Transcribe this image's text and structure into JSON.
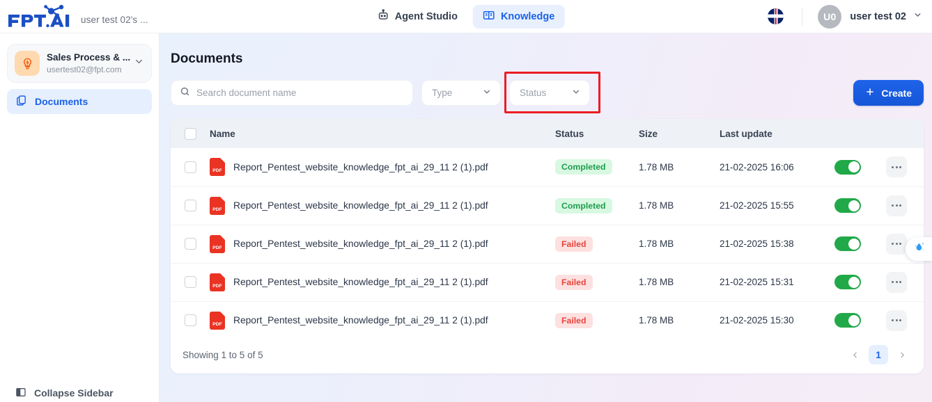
{
  "brand": {
    "name": "FPT.AI",
    "workspace_label": "user test 02's ..."
  },
  "topnav": {
    "items": [
      {
        "label": "Agent Studio",
        "icon": "robot-icon",
        "active": false
      },
      {
        "label": "Knowledge",
        "icon": "book-icon",
        "active": true
      }
    ]
  },
  "topright": {
    "language_icon": "uk-flag-icon",
    "avatar_initials": "U0",
    "user_name": "user test 02",
    "chevron_icon": "chevron-down-icon"
  },
  "sidebar": {
    "workspace": {
      "icon": "lightbulb-icon",
      "title": "Sales Process & ...",
      "email": "usertest02@fpt.com",
      "chevron_icon": "chevron-down-icon"
    },
    "items": [
      {
        "label": "Documents",
        "icon": "documents-icon",
        "active": true
      }
    ],
    "collapse": {
      "label": "Collapse Sidebar",
      "icon": "panel-collapse-icon"
    }
  },
  "main": {
    "title": "Documents",
    "search": {
      "placeholder": "Search document name",
      "value": "",
      "icon": "search-icon"
    },
    "type_filter": {
      "label": "Type",
      "value": "",
      "icon": "chevron-down-icon"
    },
    "status_filter": {
      "label": "Status",
      "value": "",
      "icon": "chevron-down-icon",
      "highlighted": true
    },
    "create_button": {
      "label": "Create",
      "icon": "plus-icon"
    },
    "highlight_color": "#ec1c24"
  },
  "table": {
    "columns": [
      "",
      "Name",
      "Status",
      "Size",
      "Last update",
      "",
      ""
    ],
    "rows": [
      {
        "name": "Report_Pentest_website_knowledge_fpt_ai_29_11 2 (1).pdf",
        "icon": "pdf-file-icon",
        "status": "Completed",
        "status_type": "completed",
        "size": "1.78 MB",
        "updated": "21-02-2025 16:06",
        "enabled": true
      },
      {
        "name": "Report_Pentest_website_knowledge_fpt_ai_29_11 2 (1).pdf",
        "icon": "pdf-file-icon",
        "status": "Completed",
        "status_type": "completed",
        "size": "1.78 MB",
        "updated": "21-02-2025 15:55",
        "enabled": true
      },
      {
        "name": "Report_Pentest_website_knowledge_fpt_ai_29_11 2 (1).pdf",
        "icon": "pdf-file-icon",
        "status": "Failed",
        "status_type": "failed",
        "size": "1.78 MB",
        "updated": "21-02-2025 15:38",
        "enabled": true
      },
      {
        "name": "Report_Pentest_website_knowledge_fpt_ai_29_11 2 (1).pdf",
        "icon": "pdf-file-icon",
        "status": "Failed",
        "status_type": "failed",
        "size": "1.78 MB",
        "updated": "21-02-2025 15:31",
        "enabled": true
      },
      {
        "name": "Report_Pentest_website_knowledge_fpt_ai_29_11 2 (1).pdf",
        "icon": "pdf-file-icon",
        "status": "Failed",
        "status_type": "failed",
        "size": "1.78 MB",
        "updated": "21-02-2025 15:30",
        "enabled": true
      }
    ],
    "pdf_badge_text": "PDF"
  },
  "footer": {
    "showing": "Showing 1 to 5 of 5",
    "prev_icon": "chevron-left-icon",
    "next_icon": "chevron-right-icon",
    "current_page": "1"
  },
  "floating_widget": {
    "icon": "water-drop-sparkle-icon"
  },
  "colors": {
    "accent_blue": "#1b62e8",
    "success_green": "#1f9d4d",
    "error_red": "#e8453c",
    "toggle_on": "#21a949"
  }
}
